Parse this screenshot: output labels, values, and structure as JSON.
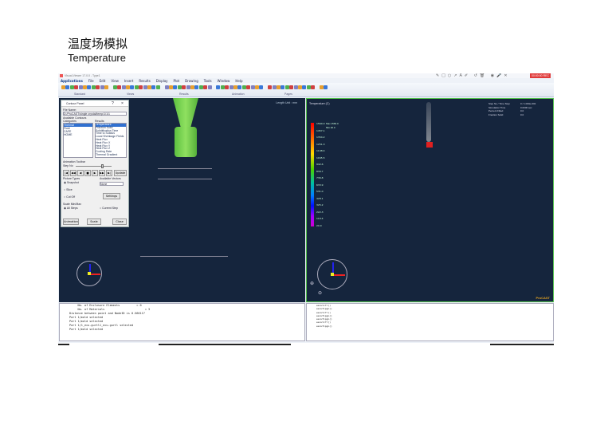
{
  "slide": {
    "title_cn": "温度场模拟",
    "title_en": "Temperature"
  },
  "app": {
    "window_title": "Visual-Viewer 17.0.0 - Type1",
    "menu": [
      "Applications",
      "File",
      "Edit",
      "View",
      "Insert",
      "Results",
      "Display",
      "Plot",
      "Drawing",
      "Tools",
      "Window",
      "Help"
    ],
    "toolbar_groups": [
      "Standard",
      "Views",
      "Results",
      "Animation",
      "Pages"
    ],
    "record_button": "00:00:00 REC"
  },
  "viewport_left": {
    "length_unit": "Length Unit : mm"
  },
  "contour_panel": {
    "title": "Contour Panel",
    "file_name_label": "File Name:",
    "file_name": "D:/ProCAST/single crystal/temp/1/1/1",
    "available_contours": "Available Contours",
    "categories_label": "Categories",
    "results_label": "Results",
    "categories": [
      "Thermal",
      "Fluid",
      "CAFE",
      "HOME"
    ],
    "results": [
      "Temperature",
      "Fraction Solid",
      "Solidification Time",
      "Time to Solidus",
      "Local Shrinkage Fields",
      "Heat Flux",
      "Heat Flux X",
      "Heat Flux Y",
      "Heat Flux Z",
      "Cooling Rate",
      "Thermal Gradient"
    ],
    "animation_toolbar": "Animation Toolbar",
    "step_no_label": "Step No",
    "update_button": "Update",
    "picture_types": "Picture Types",
    "options": [
      "Snapshot",
      "Slice",
      "Cut Off"
    ],
    "available_vectors": "Available Vectors",
    "vector_value": "None",
    "settings_button": "Settings",
    "scale_label": "Scale Min/Max",
    "scale_options": [
      "All Steps",
      "Current Step"
    ],
    "animation_button": "Animation",
    "scale_button": "Scale",
    "close_button": "Close"
  },
  "viewport_right": {
    "legend_title": "Temperature (C)",
    "max_label": "Max",
    "min_label": "Min",
    "max_value": "1560.0",
    "min_value": "20.0",
    "legend_values": [
      "1560.0",
      "1457.1",
      "1354.2",
      "1251.3",
      "1148.4",
      "1045.5",
      "942.6",
      "839.7",
      "736.8",
      "633.9",
      "531.0",
      "428.1",
      "325.2",
      "222.3",
      "119.4",
      "20.0"
    ],
    "info_labels": [
      "Step No / Time Step",
      "Simulation Time",
      "Percent Filled",
      "Fraction Solid"
    ],
    "info_values": [
      "0 / 1.000e-002",
      "0.0000 sec",
      "0.0",
      "0.0"
    ],
    "logo": "ProCAST"
  },
  "console_left": [
    "     No. of Enclosure Elements          = 0",
    "     No. of Materials                        = 3",
    "Distance between point and NodeID is 0.560117",
    "Part 1/mold selected",
    "Part 1/mold selected",
    "Part 1/1_ecu-gurtl1_ecu-gurtl selected",
    "Part 1/mold selected"
  ],
  "console_right": [
    "eecutcfr()",
    "eecutlpgn()",
    "eecutcfr()",
    "eecutlpgn()",
    "eecutlpgn()",
    "eecutcfr()",
    "eecutlpgn()"
  ],
  "colors": {
    "viewport_bg": "#15253d",
    "active_border": "#4fc04a",
    "part_green": "#6fd04a",
    "rec_red": "#e03a3a"
  }
}
